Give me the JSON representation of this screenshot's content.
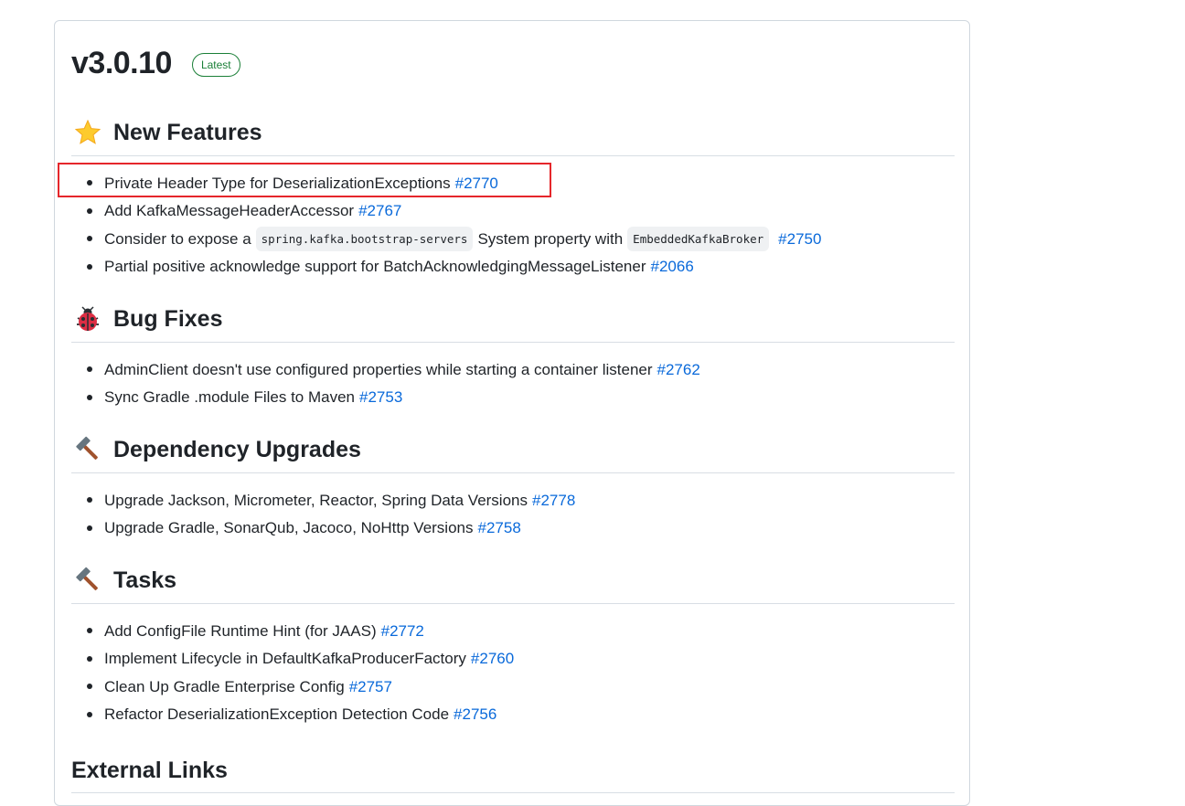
{
  "release": {
    "version": "v3.0.10",
    "badge": "Latest"
  },
  "sections": [
    {
      "title": "New Features",
      "icon": "star-icon",
      "items": [
        {
          "text": "Private Header Type for DeserializationExceptions",
          "link": "#2770"
        },
        {
          "text": "Add KafkaMessageHeaderAccessor",
          "link": "#2767"
        },
        {
          "text_before": "Consider to expose a",
          "code1": "spring.kafka.bootstrap-servers",
          "text_middle": "System property with",
          "code2": "EmbeddedKafkaBroker",
          "link": "#2750"
        },
        {
          "text": "Partial positive acknowledge support for BatchAcknowledgingMessageListener",
          "link": "#2066"
        }
      ]
    },
    {
      "title": "Bug Fixes",
      "icon": "ladybug-icon",
      "items": [
        {
          "text": "AdminClient doesn't use configured properties while starting a container listener",
          "link": "#2762"
        },
        {
          "text": "Sync Gradle .module Files to Maven",
          "link": "#2753"
        }
      ]
    },
    {
      "title": "Dependency Upgrades",
      "icon": "hammer-icon",
      "items": [
        {
          "text": "Upgrade Jackson, Micrometer, Reactor, Spring Data Versions",
          "link": "#2778"
        },
        {
          "text": "Upgrade Gradle, SonarQub, Jacoco, NoHttp Versions",
          "link": "#2758"
        }
      ]
    },
    {
      "title": "Tasks",
      "icon": "hammer-icon",
      "items": [
        {
          "text": "Add ConfigFile Runtime Hint (for JAAS)",
          "link": "#2772"
        },
        {
          "text": "Implement Lifecycle in DefaultKafkaProducerFactory",
          "link": "#2760"
        },
        {
          "text": "Clean Up Gradle Enterprise Config",
          "link": "#2757"
        },
        {
          "text": "Refactor DeserializationException Detection Code",
          "link": "#2756"
        }
      ]
    }
  ],
  "external_links": {
    "title": "External Links"
  },
  "colors": {
    "link": "#0969da",
    "badge": "#1a7f37",
    "highlight_box": "#e5262b"
  }
}
